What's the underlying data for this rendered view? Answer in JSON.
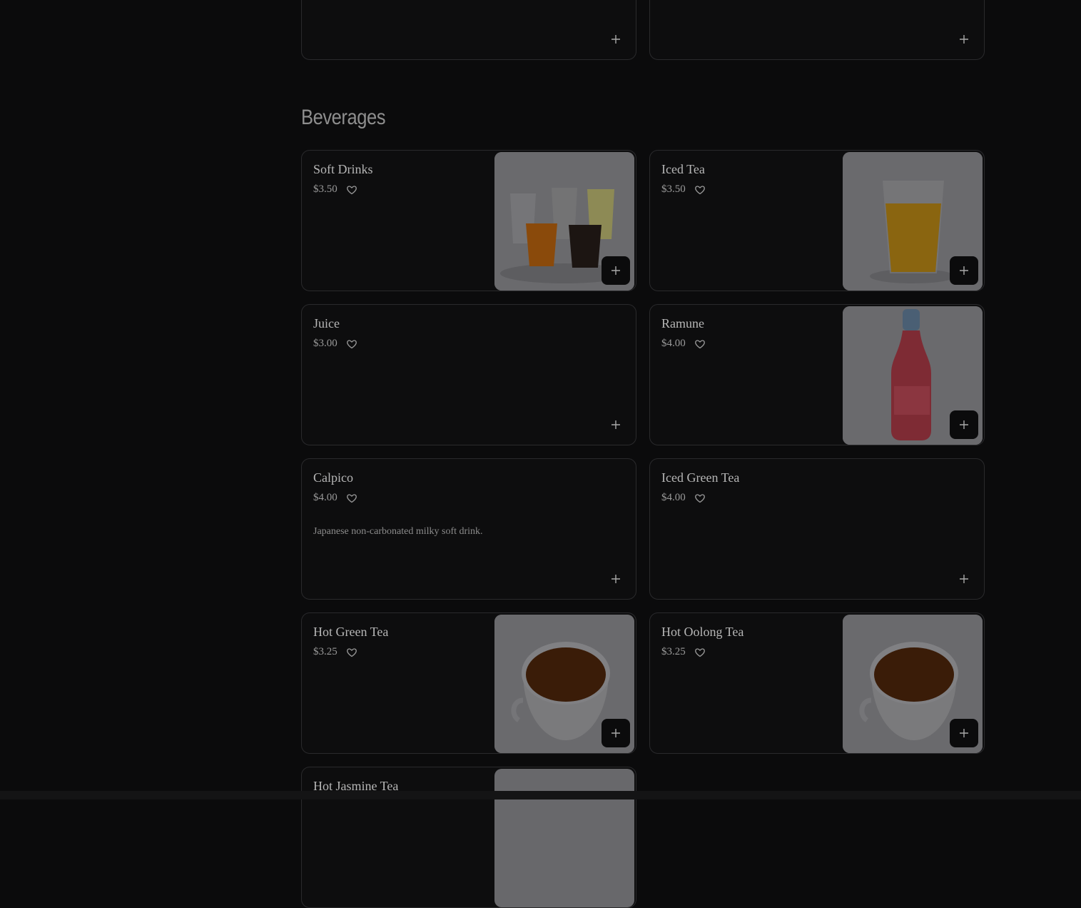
{
  "section": {
    "title": "Beverages"
  },
  "items": [
    {
      "name": "Soft Drinks",
      "price": "$3.50",
      "description": ""
    },
    {
      "name": "Iced Tea",
      "price": "$3.50",
      "description": ""
    },
    {
      "name": "Juice",
      "price": "$3.00",
      "description": ""
    },
    {
      "name": "Ramune",
      "price": "$4.00",
      "description": ""
    },
    {
      "name": "Calpico",
      "price": "$4.00",
      "description": "Japanese non-carbonated milky soft drink."
    },
    {
      "name": "Iced Green Tea",
      "price": "$4.00",
      "description": ""
    },
    {
      "name": "Hot Green Tea",
      "price": "$3.25",
      "description": ""
    },
    {
      "name": "Hot Oolong Tea",
      "price": "$3.25",
      "description": ""
    },
    {
      "name": "Hot Jasmine Tea",
      "price": "",
      "description": ""
    }
  ],
  "icons": {
    "favorite": "heart-icon",
    "add": "plus-icon"
  },
  "colors": {
    "background": "#0b0b0c",
    "card_border": "#2a2a2c",
    "text": "#b6b6b6"
  }
}
